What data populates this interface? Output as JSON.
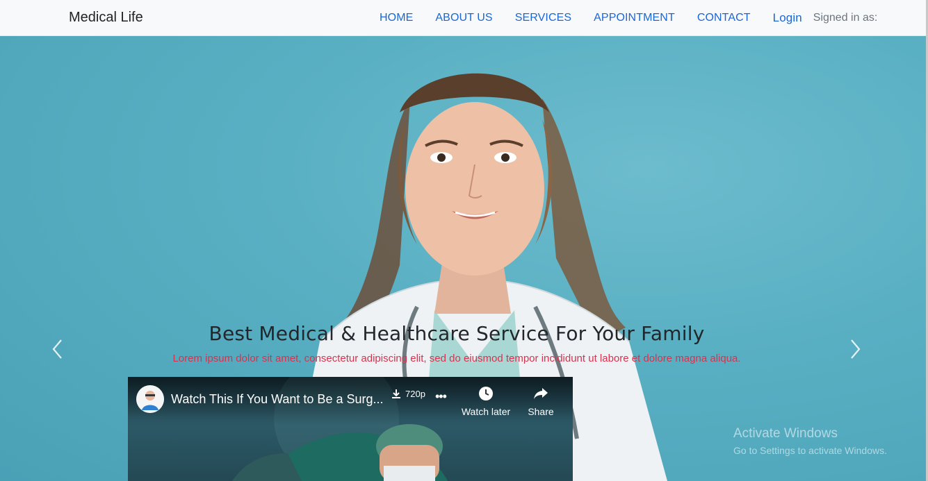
{
  "brand": "Medical Life",
  "nav": {
    "items": [
      "HOME",
      "ABOUT US",
      "SERVICES",
      "APPOINTMENT",
      "CONTACT"
    ],
    "login": "Login",
    "signed_in": "Signed in as:"
  },
  "hero": {
    "title": "Best Medical & Healthcare Service For Your Family",
    "subtitle": "Lorem ipsum dolor sit amet, consectetur adipiscing elit, sed do eiusmod tempor incididunt ut labore et dolore magna aliqua.",
    "prev_icon": "chevron-left-icon",
    "next_icon": "chevron-right-icon"
  },
  "video": {
    "title": "Watch This If You Want to Be a Surg...",
    "quality": "720p",
    "watch_later": "Watch later",
    "share": "Share"
  },
  "windows": {
    "title": "Activate Windows",
    "subtitle": "Go to Settings to activate Windows."
  },
  "colors": {
    "nav_link": "#1a66d6",
    "hero_bg": "#5ab0c3",
    "subtitle": "#d6334f"
  }
}
